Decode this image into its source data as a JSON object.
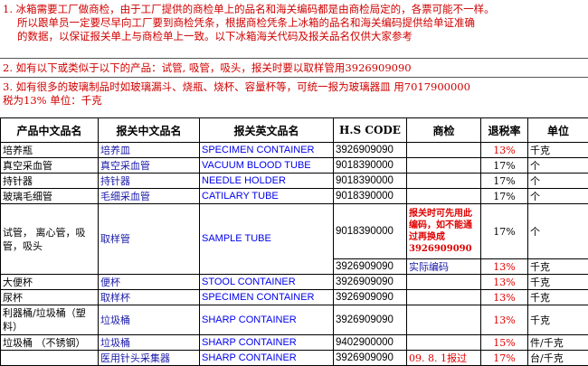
{
  "notes": {
    "n1_l1": "1. 冰箱需要工厂做商检，由于工厂提供的商检单上的品名和海关编码都是由商检局定的，各票可能不一样。",
    "n1_l2": "所以跟单员一定要尽早向工厂要到商检凭条，根据商检凭条上冰箱的品名和海关编码提供给单证准确",
    "n1_l3": "的数据，以保证报关单上与商检单上一致。以下冰箱海关代码及报关品名仅供大家参考",
    "n2": "2. 如有以下或类似于以下的产品：试管, 吸管，吸头，报关时要以取样管用3926909090",
    "n3_l1": "3. 如有很多的玻璃制品时如玻璃漏斗、烧瓶、烧杯、容量杯等，可统一报为玻璃器皿    用7017900000",
    "n3_l2": "税为13%        单位：千克"
  },
  "table": {
    "headers": [
      "产品中文品名",
      "报关中文品名",
      "报关英文品名",
      "H.S  CODE",
      "商检",
      "退税率",
      "单位"
    ],
    "rows": [
      {
        "cn": "培养瓶",
        "decl_cn": "培养皿",
        "decl_en": "SPECIMEN CONTAINER",
        "hs": "3926909090",
        "inspection": "",
        "rebate": "13%",
        "unit": "千克"
      },
      {
        "cn": "真空采血管",
        "decl_cn": "真空采血管",
        "decl_en": "VACUUM BLOOD TUBE",
        "hs": "9018390000",
        "inspection": "",
        "rebate": "17%",
        "unit": "个"
      },
      {
        "cn": "持针器",
        "decl_cn": "持针器",
        "decl_en": "NEEDLE HOLDER",
        "hs": "9018390000",
        "inspection": "",
        "rebate": "17%",
        "unit": "个"
      },
      {
        "cn": "玻璃毛细管",
        "decl_cn": "毛细采血管",
        "decl_en": "CATILARY TUBE",
        "hs": "9018390000",
        "inspection": "",
        "rebate": "17%",
        "unit": "个"
      },
      {
        "cn": "试管，  离心管，吸管，吸头",
        "decl_cn": "取样管",
        "decl_en": "SAMPLE TUBE",
        "hs": "9018390000",
        "inspection": "报关时可先用此编码，如不能通过再换成3926909090",
        "rebate": "17%",
        "unit": "个"
      },
      {
        "cn": "",
        "decl_cn": "",
        "decl_en": "",
        "hs": "3926909090",
        "inspection": "实际编码",
        "rebate": "13%",
        "unit": "千克"
      },
      {
        "cn": "大便杯",
        "decl_cn": "便杯",
        "decl_en": "STOOL CONTAINER",
        "hs": "3926909090",
        "inspection": "",
        "rebate": "13%",
        "unit": "千克"
      },
      {
        "cn": "尿杯",
        "decl_cn": "取样杯",
        "decl_en": "SPECIMEN CONTAINER",
        "hs": "3926909090",
        "inspection": "",
        "rebate": "13%",
        "unit": "千克"
      },
      {
        "cn": "利器桶/垃圾桶（塑料）",
        "decl_cn": "垃圾桶",
        "decl_en": "SHARP CONTAINER",
        "hs": "3926909090",
        "inspection": "",
        "rebate": "13%",
        "unit": "千克"
      },
      {
        "cn": "垃圾桶  （不锈钢）",
        "decl_cn": "垃圾桶",
        "decl_en": "SHARP CONTAINER",
        "hs": "9402900000",
        "inspection": "",
        "rebate": "15%",
        "unit": "件/千克"
      },
      {
        "cn": "",
        "decl_cn": "医用针头采集器",
        "decl_en": "SHARP CONTAINER",
        "hs": "3926909090",
        "inspection": "09. 8. 1报过",
        "rebate": "17%",
        "unit": "台/千克"
      }
    ]
  },
  "colors": {
    "note_red": "#d00000",
    "cn_blue": "#1a1aa8",
    "en_blue": "#0000ee",
    "rate_red": "#e00000"
  }
}
